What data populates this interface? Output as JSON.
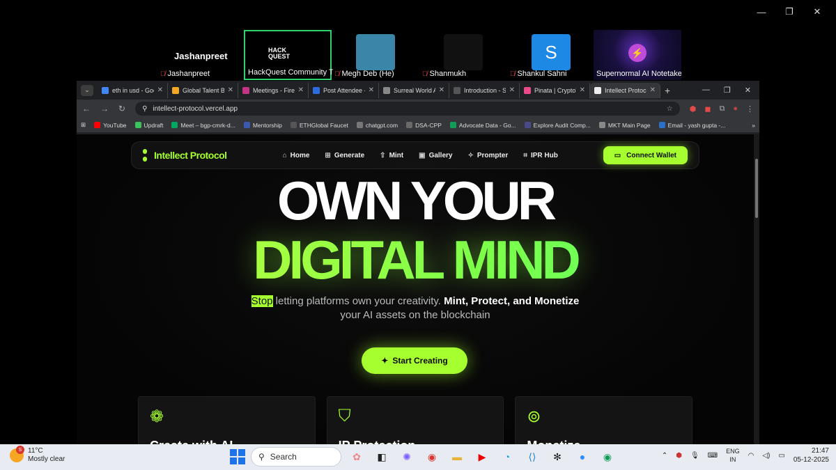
{
  "zoom": {
    "participants": [
      {
        "name": "Jashanpreet",
        "display": "Jashanpreet",
        "muted": true
      },
      {
        "name": "HackQuest Community Te...",
        "muted": false,
        "active": true,
        "logo": "HACK QUEST"
      },
      {
        "name": "Megh Deb (He)",
        "muted": true
      },
      {
        "name": "Shanmukh",
        "muted": true
      },
      {
        "name": "Shankul Sahni",
        "muted": true,
        "letter": "S"
      },
      {
        "name": "Supernormal AI Notetaker",
        "muted": false
      }
    ]
  },
  "browser": {
    "tabs": [
      {
        "label": "eth in usd - Goo",
        "color": "#4285f4"
      },
      {
        "label": "Global Talent Ba",
        "color": "#f5a623"
      },
      {
        "label": "Meetings - Firefli",
        "color": "#c13584"
      },
      {
        "label": "Post Attendee -",
        "color": "#2d6cdf"
      },
      {
        "label": "Surreal World Ass",
        "color": "#111111"
      },
      {
        "label": "Introduction - St",
        "color": "#333333"
      },
      {
        "label": "Pinata | Crypto's",
        "color": "#e94b8a"
      },
      {
        "label": "Intellect Protoco",
        "color": "#222222",
        "active": true
      }
    ],
    "url": "intellect-protocol.vercel.app",
    "bookmarks": [
      {
        "label": "YouTube",
        "color": "#ff0000"
      },
      {
        "label": "Updraft",
        "color": "#3ac35a"
      },
      {
        "label": "Meet – bgp-cmrk-d...",
        "color": "#00a862"
      },
      {
        "label": "Mentorship",
        "color": "#3a5ab0"
      },
      {
        "label": "ETHGlobal Faucet",
        "color": "#555555"
      },
      {
        "label": "chatgpt.com",
        "color": "#777777"
      },
      {
        "label": "DSA-CPP",
        "color": "#6a6a6a"
      },
      {
        "label": "Advocate Data - Go...",
        "color": "#0f9d58"
      },
      {
        "label": "Explore Audit Comp...",
        "color": "#4a4a8a"
      },
      {
        "label": "MKT Main Page",
        "color": "#888888"
      },
      {
        "label": "Email - yash gupta -...",
        "color": "#2a70c8"
      }
    ]
  },
  "site": {
    "brand": "Intellect Protocol",
    "nav": [
      {
        "label": "Home",
        "icon": "home-icon",
        "glyph": "⌂"
      },
      {
        "label": "Generate",
        "icon": "plus-square-icon",
        "glyph": "⊞"
      },
      {
        "label": "Mint",
        "icon": "upload-icon",
        "glyph": "⇧"
      },
      {
        "label": "Gallery",
        "icon": "image-icon",
        "glyph": "▣"
      },
      {
        "label": "Prompter",
        "icon": "sparkles-icon",
        "glyph": "✧"
      },
      {
        "label": "IPR Hub",
        "icon": "bracket-icon",
        "glyph": "⌗"
      }
    ],
    "connect_wallet": "Connect Wallet",
    "hero_line1": "OWN YOUR",
    "hero_line2": "DIGITAL MIND",
    "sub_highlight": "Stop",
    "sub_rest": " letting platforms own your creativity. ",
    "sub_bold": "Mint, Protect, and Monetize",
    "sub_line2": "your AI assets on the blockchain",
    "cta": "Start Creating",
    "cards": [
      {
        "title": "Create with AI",
        "icon": "brain-icon",
        "glyph": "❁"
      },
      {
        "title": "IP Protection",
        "icon": "shield-check-icon",
        "glyph": "⛉"
      },
      {
        "title": "Monetize",
        "icon": "coins-icon",
        "glyph": "⊚"
      }
    ],
    "accent": "#a6ff2e"
  },
  "taskbar": {
    "temp": "11°C",
    "weather": "Mostly clear",
    "search": "Search",
    "lang1": "ENG",
    "lang2": "IN",
    "time": "21:47",
    "date": "05-12-2025"
  }
}
